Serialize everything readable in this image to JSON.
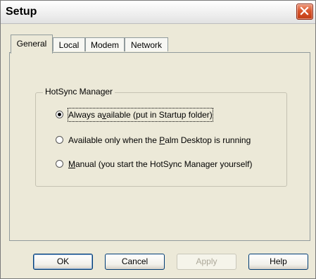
{
  "window": {
    "title": "Setup"
  },
  "tabs": [
    {
      "label": "General",
      "active": true
    },
    {
      "label": "Local",
      "active": false
    },
    {
      "label": "Modem",
      "active": false
    },
    {
      "label": "Network",
      "active": false
    }
  ],
  "group": {
    "label": "HotSync Manager",
    "options": [
      {
        "pre": "Always a",
        "u": "v",
        "post": "ailable (put in Startup folder)",
        "selected": true
      },
      {
        "pre": "Available only when the ",
        "u": "P",
        "post": "alm Desktop is running",
        "selected": false
      },
      {
        "pre": "",
        "u": "M",
        "post": "anual (you start the HotSync Manager yourself)",
        "selected": false
      }
    ]
  },
  "buttons": {
    "ok": "OK",
    "cancel": "Cancel",
    "apply": "Apply",
    "help": "Help"
  }
}
